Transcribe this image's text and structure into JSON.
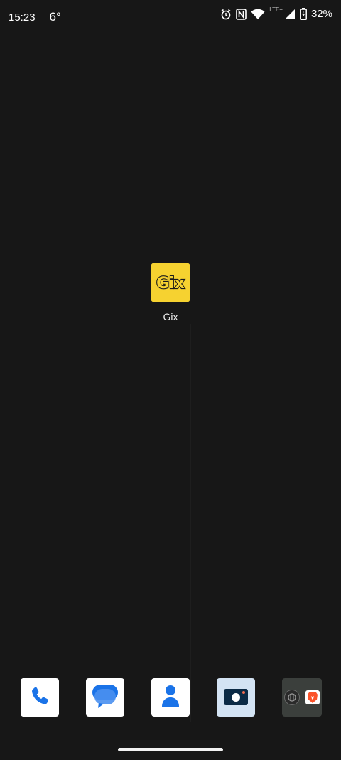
{
  "status_bar": {
    "time": "15:23",
    "temperature": "6°",
    "network_type": "LTE+",
    "battery": "32%",
    "icons": [
      "alarm-icon",
      "nfc-icon",
      "wifi-icon",
      "signal-icon",
      "battery-charging-icon"
    ]
  },
  "home": {
    "apps": [
      {
        "label": "Gix",
        "icon_text": "Gix",
        "icon_color": "#f6d230"
      }
    ]
  },
  "dock": {
    "items": [
      {
        "name": "phone",
        "icon": "phone-icon"
      },
      {
        "name": "messages",
        "icon": "messages-icon"
      },
      {
        "name": "contacts",
        "icon": "contacts-icon"
      },
      {
        "name": "camera",
        "icon": "camera-icon"
      },
      {
        "name": "folder",
        "icon": "folder-icon",
        "contents": [
          "app-icon",
          "brave-icon"
        ]
      }
    ]
  },
  "colors": {
    "background": "#171717",
    "accent_blue": "#1a73e8",
    "gix_yellow": "#f6d230",
    "brave_orange": "#fb542b"
  }
}
